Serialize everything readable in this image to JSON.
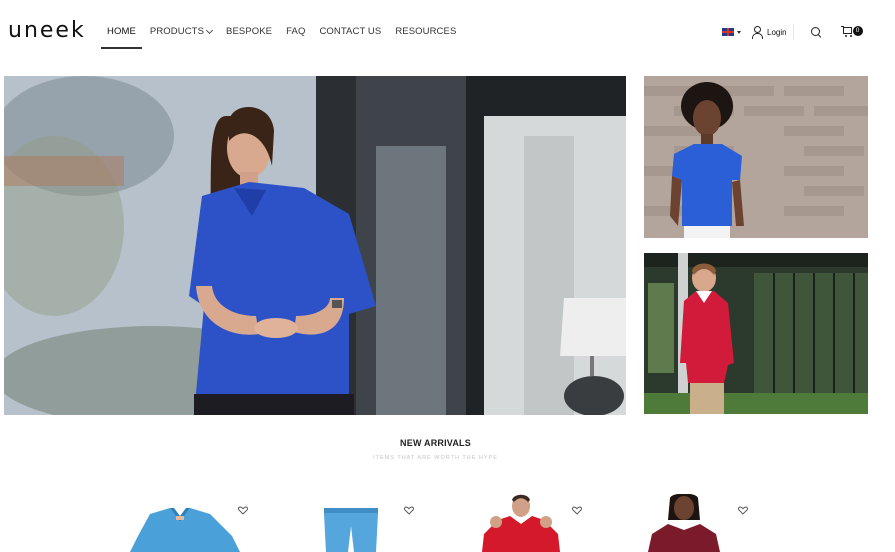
{
  "brand": {
    "logo_text": "uneek"
  },
  "nav": {
    "items": [
      {
        "label": "HOME",
        "active": true
      },
      {
        "label": "PRODUCTS",
        "has_dropdown": true
      },
      {
        "label": "BESPOKE"
      },
      {
        "label": "FAQ"
      },
      {
        "label": "CONTACT US"
      },
      {
        "label": "RESOURCES"
      }
    ]
  },
  "header_tools": {
    "language_icon": "uk-flag-icon",
    "login_label": "Login",
    "search_icon": "search-icon",
    "cart_icon": "cart-icon",
    "cart_count": "0"
  },
  "hero": {
    "main_image": "woman-in-blue-polo-shirt",
    "side_images": [
      "woman-in-blue-t-shirt",
      "man-in-red-rugby-shirt"
    ]
  },
  "new_arrivals": {
    "title": "NEW ARRIVALS",
    "subtitle": "ITEMS THAT ARE WORTH THE HYPE",
    "products": [
      {
        "image": "blue-scrub-top",
        "wishlist_icon": "heart-icon"
      },
      {
        "image": "blue-scrub-trousers",
        "wishlist_icon": "heart-icon"
      },
      {
        "image": "man-in-red-hoodie",
        "wishlist_icon": "heart-icon"
      },
      {
        "image": "woman-in-burgundy-hoodie",
        "wishlist_icon": "heart-icon"
      }
    ]
  },
  "colors": {
    "text": "#222222",
    "accent_blue": "#2a4fc4",
    "accent_red": "#c8102e",
    "subtitle_grey": "#c4c4c4"
  }
}
